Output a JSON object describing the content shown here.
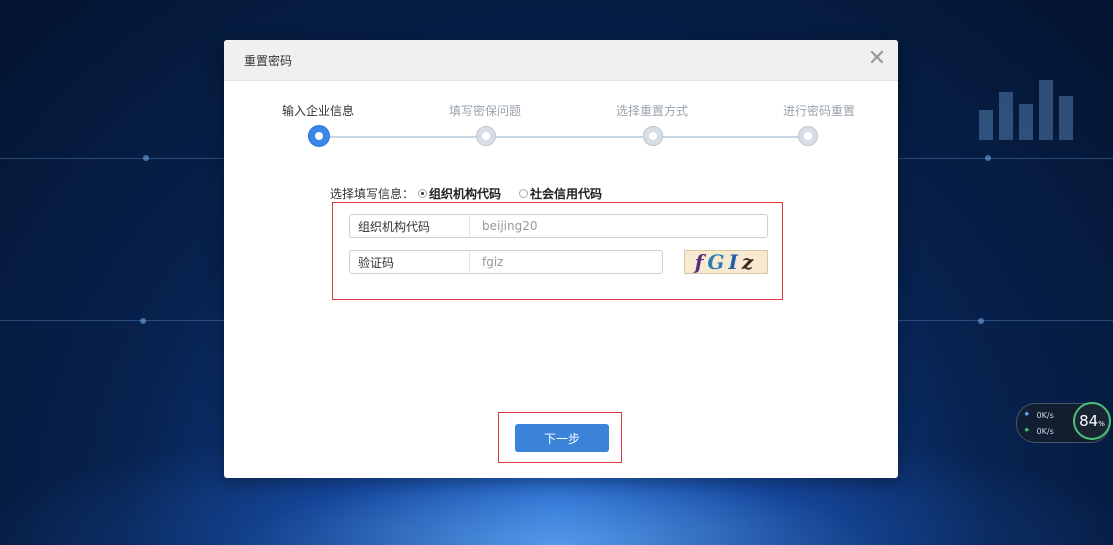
{
  "dialog": {
    "title": "重置密码",
    "close_icon": "close-icon"
  },
  "steps": [
    {
      "label": "输入企业信息",
      "active": true
    },
    {
      "label": "填写密保问题",
      "active": false
    },
    {
      "label": "选择重置方式",
      "active": false
    },
    {
      "label": "进行密码重置",
      "active": false
    }
  ],
  "choose": {
    "label": "选择填写信息：",
    "options": [
      {
        "label": "组织机构代码",
        "checked": true
      },
      {
        "label": "社会信用代码",
        "checked": false
      }
    ]
  },
  "form": {
    "org_code": {
      "label": "组织机构代码",
      "value": "beijing20"
    },
    "captcha": {
      "label": "验证码",
      "value": "fgiz",
      "image_text": [
        "f",
        "G",
        "I",
        "z"
      ]
    }
  },
  "next_button": {
    "label": "下一步"
  },
  "speed_widget": {
    "upload": "0K/s",
    "download": "0K/s",
    "percent": "84",
    "unit": "%"
  },
  "colors": {
    "accent": "#3b82d9",
    "highlight": "#d9363e",
    "success": "#4fc07a"
  }
}
